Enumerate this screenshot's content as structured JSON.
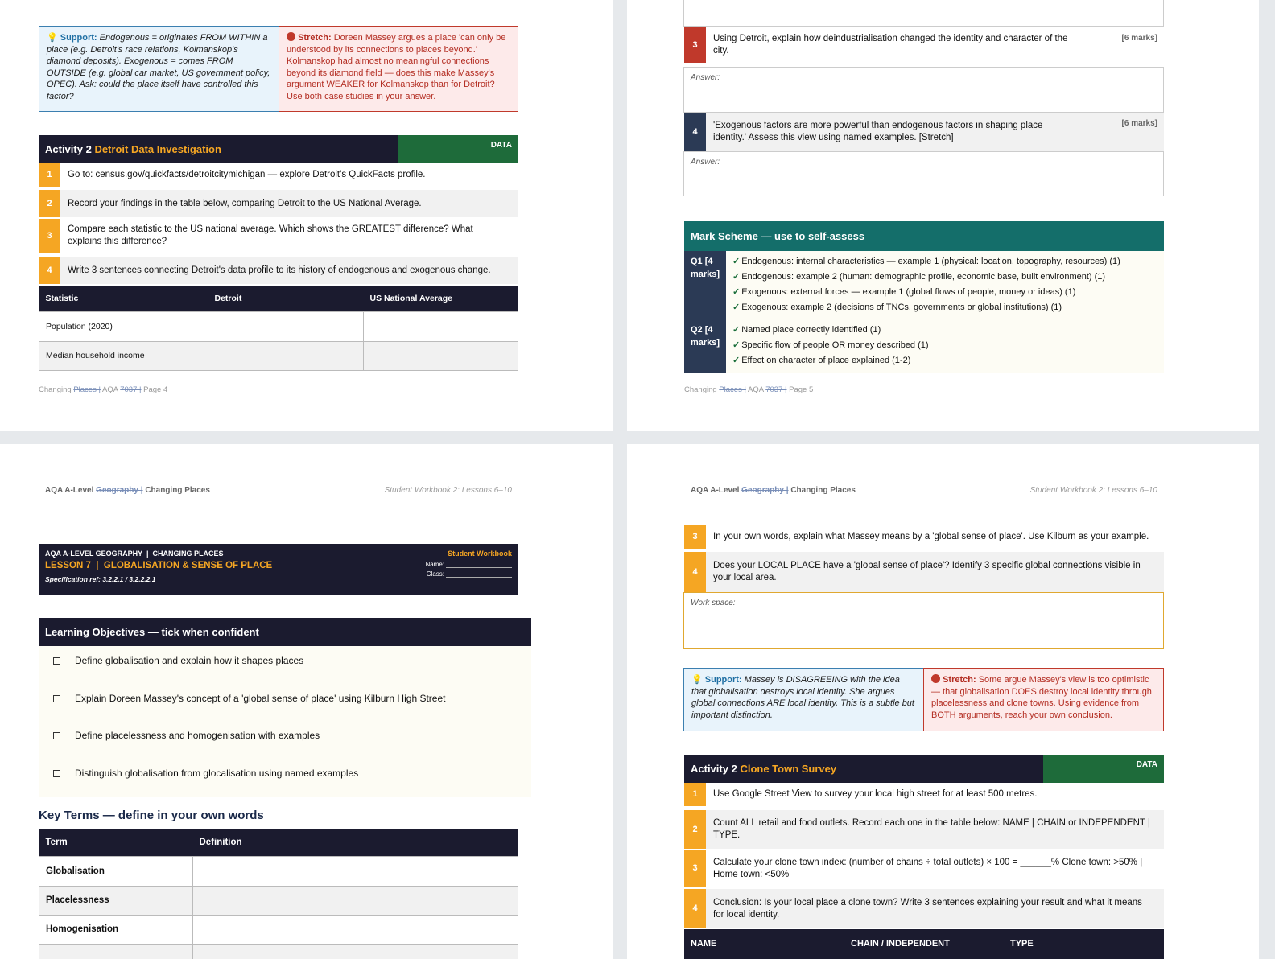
{
  "page4": {
    "support_label": "Support:",
    "support_text": "Endogenous = originates FROM WITHIN a place (e.g. Detroit's race relations, Kolmanskop's diamond deposits). Exogenous = comes FROM OUTSIDE (e.g. global car market, US government policy, OPEC). Ask: could the place itself have controlled this factor?",
    "stretch_label": "Stretch:",
    "stretch_text": "Doreen Massey argues a place 'can only be understood by its connections to places beyond.' Kolmanskop had almost no meaningful connections beyond its diamond field — does this make Massey's argument WEAKER for Kolmanskop than for Detroit? Use both case studies in your answer.",
    "activity_label": "Activity 2",
    "activity_title": "Detroit Data Investigation",
    "badge": "DATA",
    "steps": [
      {
        "n": "1",
        "text": "Go to: census.gov/quickfacts/detroitcitymichigan — explore Detroit's QuickFacts profile."
      },
      {
        "n": "2",
        "text": "Record your findings in the table below, comparing Detroit to the US National Average."
      },
      {
        "n": "3",
        "text": "Compare each statistic to the US national average. Which shows the GREATEST difference? What explains this difference?"
      },
      {
        "n": "4",
        "text": "Write 3 sentences connecting Detroit's data profile to its history of endogenous and exogenous change."
      }
    ],
    "table_headers": [
      "Statistic",
      "Detroit",
      "US National Average"
    ],
    "table_rows": [
      "Population (2020)",
      "Median household income"
    ],
    "footer": {
      "a": "Changing ",
      "b": "Places |",
      "c": " AQA ",
      "d": "7037 |",
      "e": " Page 4"
    }
  },
  "page5": {
    "q3": {
      "n": "3",
      "text": "Using Detroit, explain how deindustrialisation changed the identity and character of the city.",
      "marks": "[6 marks]"
    },
    "q4": {
      "n": "4",
      "text": "'Exogenous factors are more powerful than endogenous factors in shaping place identity.' Assess this view using named examples. [Stretch]",
      "marks": "[6 marks]"
    },
    "answer_label": "Answer:",
    "ms_title": "Mark Scheme — use to self-assess",
    "ms_q1": "Q1 [4 marks]",
    "ms_q2": "Q2 [4 marks]",
    "check": "✓",
    "ms_q1_items": [
      "Endogenous: internal characteristics — example 1 (physical: location, topography, resources) (1)",
      "Endogenous: example 2 (human: demographic profile, economic base, built environment) (1)",
      "Exogenous: external forces — example 1 (global flows of people, money or ideas) (1)",
      "Exogenous: example 2 (decisions of TNCs, governments or global institutions) (1)"
    ],
    "ms_q2_items": [
      "Named place correctly identified (1)",
      "Specific flow of people OR money described (1)",
      "Effect on character of place explained (1-2)"
    ],
    "footer": {
      "a": "Changing ",
      "b": "Places |",
      "c": " AQA ",
      "d": "7037 |",
      "e": " Page 5"
    }
  },
  "page6": {
    "hdr_a": "AQA A-Level ",
    "hdr_b": "Geography |",
    "hdr_c": " Changing Places",
    "hdr_right": "Student Workbook 2: Lessons 6–10",
    "banner_top": "AQA A-LEVEL GEOGRAPHY  |  CHANGING PLACES",
    "banner_lesson": "LESSON 7  |  GLOBALISATION & SENSE OF PLACE",
    "banner_spec": "Specification ref: 3.2.2.1 / 3.2.2.2.1",
    "banner_right": "Student Workbook",
    "name_label": "Name:",
    "class_label": "Class:",
    "lo_title": "Learning Objectives — tick when confident",
    "objectives": [
      "Define globalisation and explain how it shapes places",
      "Explain Doreen Massey's concept of a 'global sense of place' using Kilburn High Street",
      "Define placelessness and homogenisation with examples",
      "Distinguish globalisation from glocalisation using named examples"
    ],
    "kt_title": "Key Terms — define in your own words",
    "kt_headers": [
      "Term",
      "Definition"
    ],
    "kt_rows": [
      "Globalisation",
      "Placelessness",
      "Homogenisation"
    ]
  },
  "page7": {
    "hdr_a": "AQA A-Level ",
    "hdr_b": "Geography |",
    "hdr_c": " Changing Places",
    "hdr_right": "Student Workbook 2: Lessons 6–10",
    "steps_top": [
      {
        "n": "3",
        "text": "In your own words, explain what Massey means by a 'global sense of place'. Use Kilburn as your example."
      },
      {
        "n": "4",
        "text": "Does your LOCAL PLACE have a 'global sense of place'? Identify 3 specific global connections visible in your local area."
      }
    ],
    "work_space": "Work space:",
    "support_label": "Support:",
    "support_text": "Massey is DISAGREEING with the idea that globalisation destroys local identity. She argues global connections ARE local identity. This is a subtle but important distinction.",
    "stretch_label": "Stretch:",
    "stretch_text": "Some argue Massey's view is too optimistic — that globalisation DOES destroy local identity through placelessness and clone towns. Using evidence from BOTH arguments, reach your own conclusion.",
    "activity_label": "Activity 2",
    "activity_title": "Clone Town Survey",
    "badge": "DATA",
    "steps": [
      {
        "n": "1",
        "text": "Use Google Street View to survey your local high street for at least 500 metres."
      },
      {
        "n": "2",
        "text": "Count ALL retail and food outlets. Record each one in the table below: NAME | CHAIN or INDEPENDENT | TYPE."
      },
      {
        "n": "3",
        "text": "Calculate your clone town index: (number of chains ÷ total outlets) × 100 = ______%   Clone town: >50%  |  Home town: <50%"
      },
      {
        "n": "4",
        "text": "Conclusion: Is your local place a clone town? Write 3 sentences explaining your result and what it means for local identity."
      }
    ],
    "table_headers": [
      "NAME",
      "CHAIN / INDEPENDENT",
      "TYPE"
    ]
  }
}
